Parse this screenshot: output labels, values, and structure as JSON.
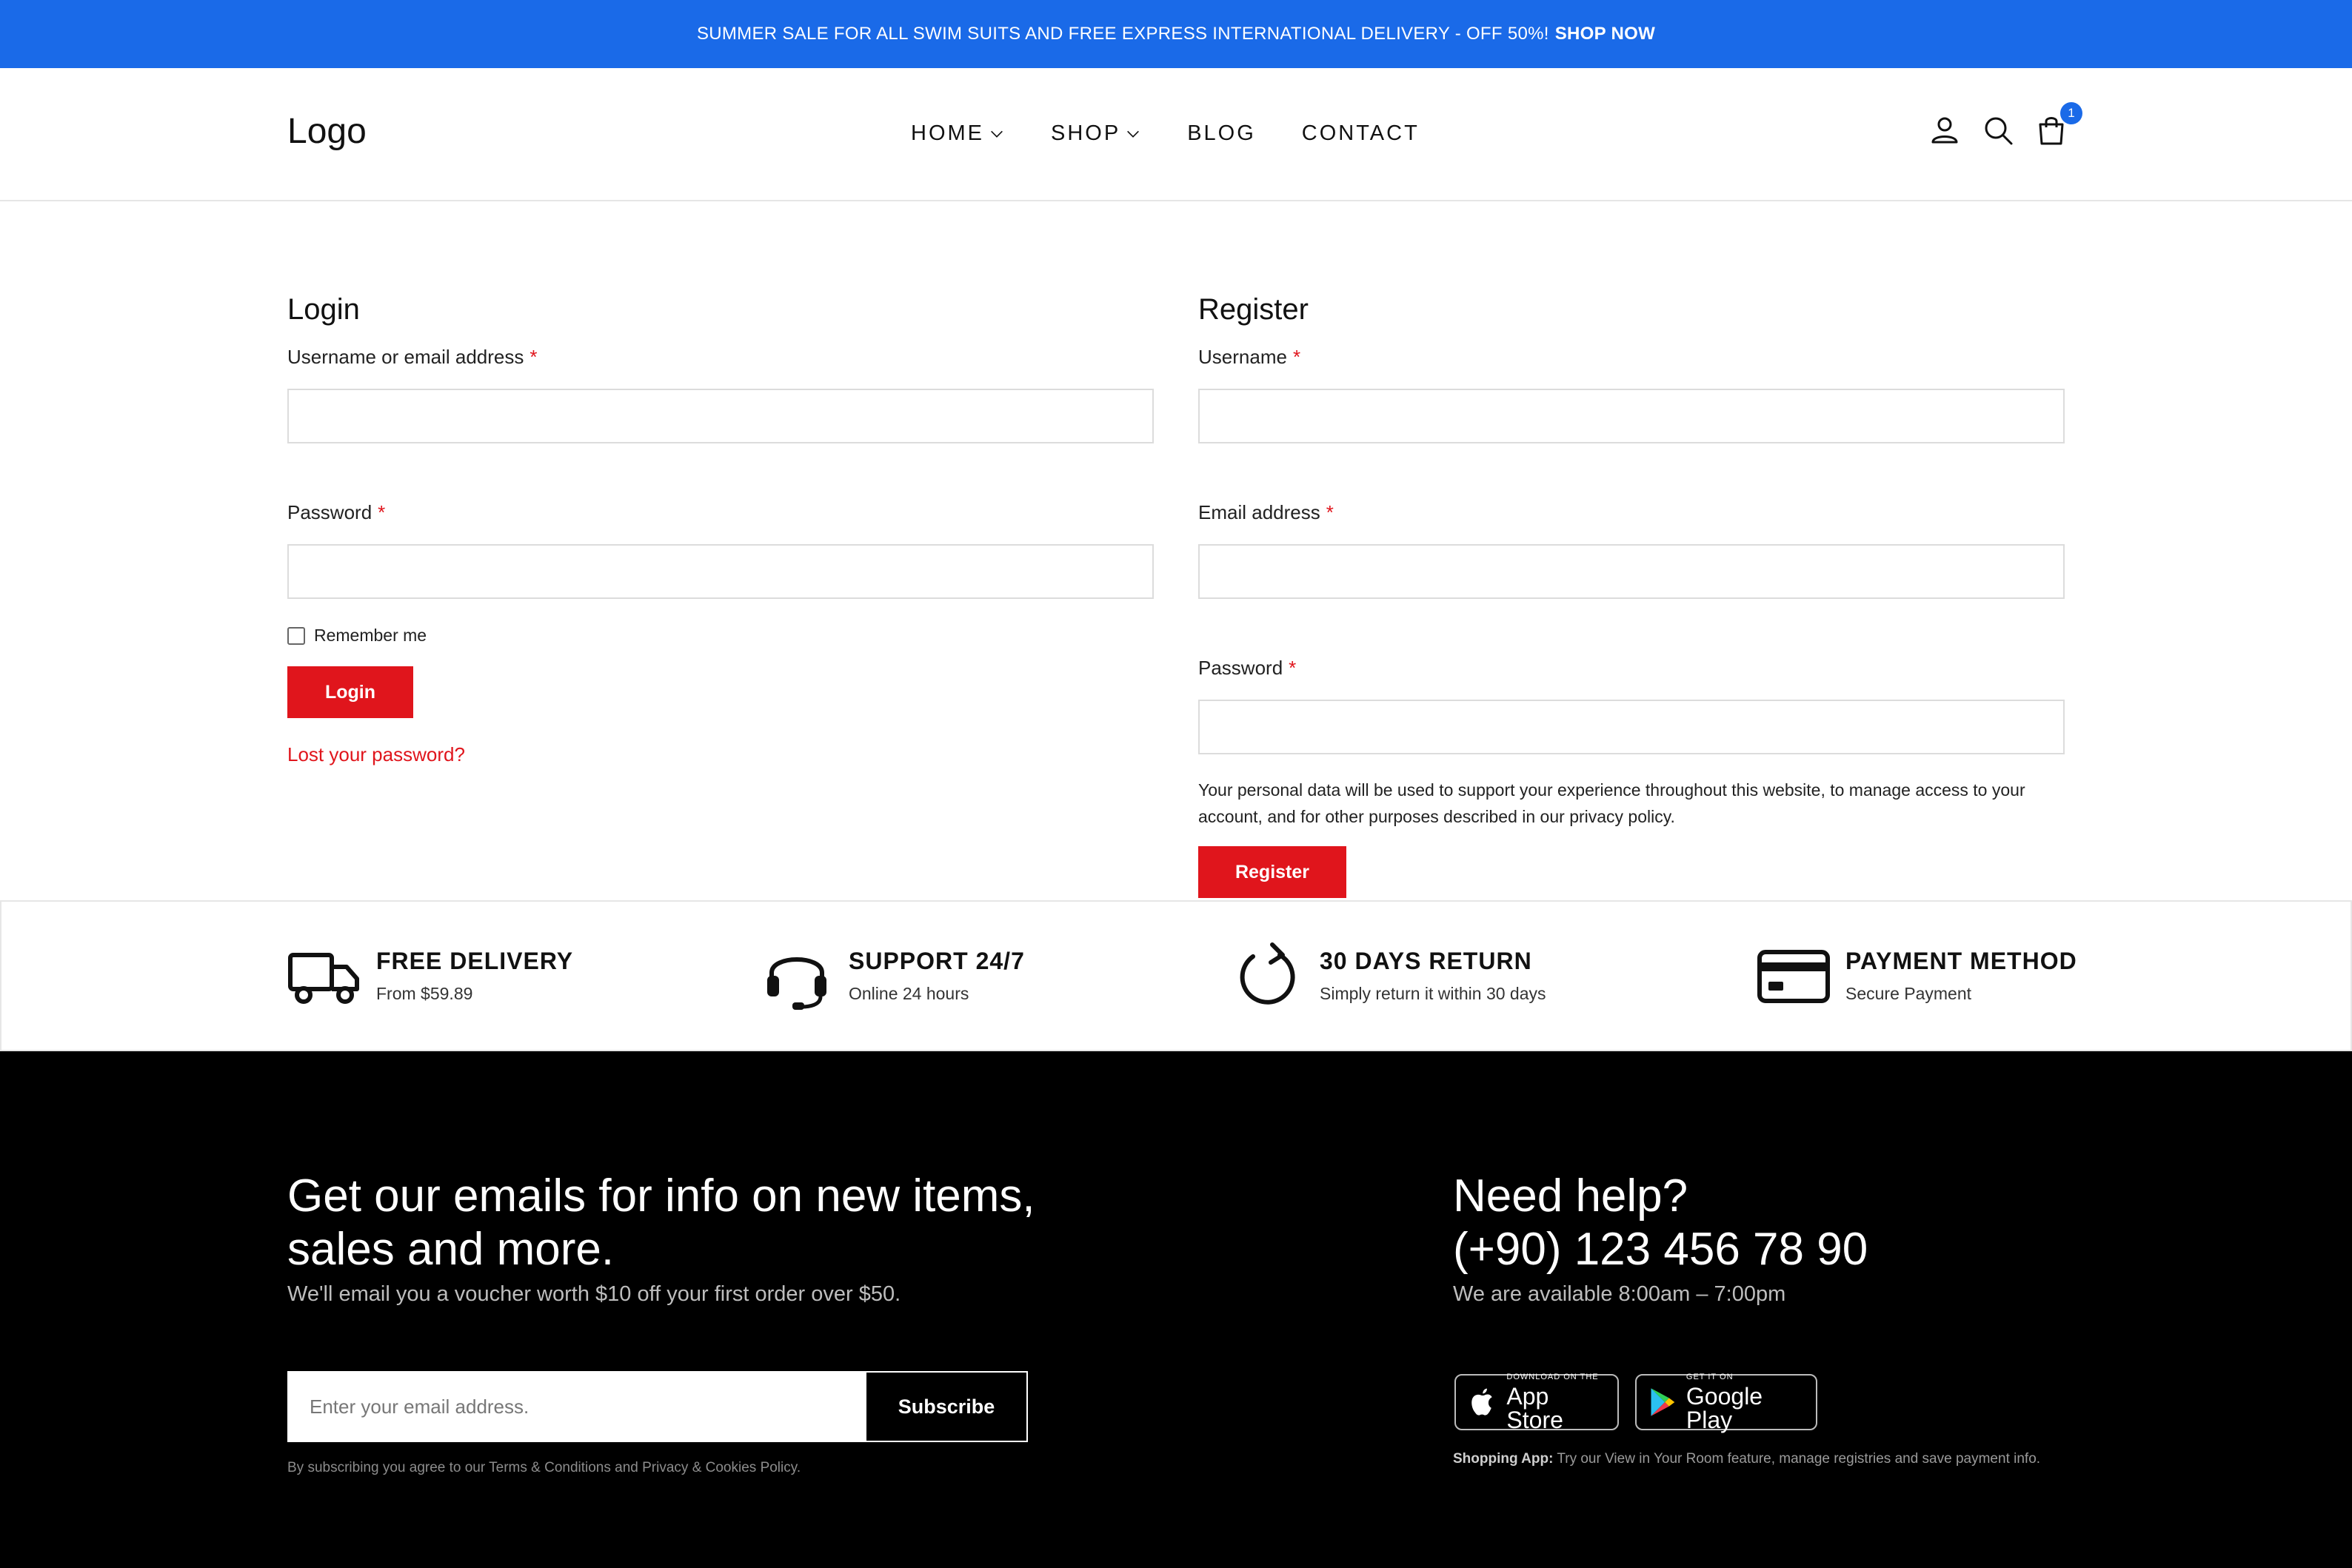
{
  "announcement": {
    "text": "SUMMER SALE FOR ALL SWIM SUITS AND FREE EXPRESS INTERNATIONAL DELIVERY - OFF 50%!",
    "link": "SHOP NOW",
    "bg_color": "#1a6ae8"
  },
  "header": {
    "logo": "Logo",
    "nav": [
      {
        "label": "HOME",
        "has_dropdown": true
      },
      {
        "label": "SHOP",
        "has_dropdown": true
      },
      {
        "label": "BLOG",
        "has_dropdown": false
      },
      {
        "label": "CONTACT",
        "has_dropdown": false
      }
    ],
    "icons": [
      "user-icon",
      "search-icon",
      "cart-icon"
    ],
    "cart_count": "1"
  },
  "login": {
    "title": "Login",
    "username_label": "Username or email address",
    "password_label": "Password",
    "required_mark": "*",
    "remember_label": "Remember me",
    "button": "Login",
    "lost_password": "Lost your password?"
  },
  "register": {
    "title": "Register",
    "username_label": "Username",
    "email_label": "Email address",
    "password_label": "Password",
    "required_mark": "*",
    "privacy": "Your personal data will be used to support your experience throughout this website, to manage access to your account, and for other purposes described in our privacy policy.",
    "button": "Register"
  },
  "features": [
    {
      "icon": "truck-icon",
      "title": "FREE DELIVERY",
      "subtitle": "From $59.89"
    },
    {
      "icon": "headset-icon",
      "title": "SUPPORT 24/7",
      "subtitle": "Online 24 hours"
    },
    {
      "icon": "refresh-icon",
      "title": "30 DAYS RETURN",
      "subtitle": "Simply return it within 30 days"
    },
    {
      "icon": "credit-card-icon",
      "title": "PAYMENT METHOD",
      "subtitle": "Secure Payment"
    }
  ],
  "footer": {
    "newsletter_title": "Get our emails for info on new items, sales and more.",
    "newsletter_sub": "We'll email you a voucher worth $10 off your first order over $50.",
    "email_placeholder": "Enter your email address.",
    "subscribe": "Subscribe",
    "legal": "By subscribing you agree to our Terms & Conditions and Privacy & Cookies Policy.",
    "help_title": "Need help?",
    "help_phone": "(+90) 123 456 78 90",
    "help_hours": "We are available 8:00am – 7:00pm",
    "app_store_small": "DOWNLOAD ON THE",
    "app_store_big": "App Store",
    "play_small": "GET IT ON",
    "play_big": "Google Play",
    "app_note_label": "Shopping App:",
    "app_note_text": "Try our View in Your Room feature, manage registries and save payment info."
  },
  "colors": {
    "accent": "#e0151c",
    "brand_blue": "#1a6ae8",
    "footer_bg": "#000000"
  }
}
